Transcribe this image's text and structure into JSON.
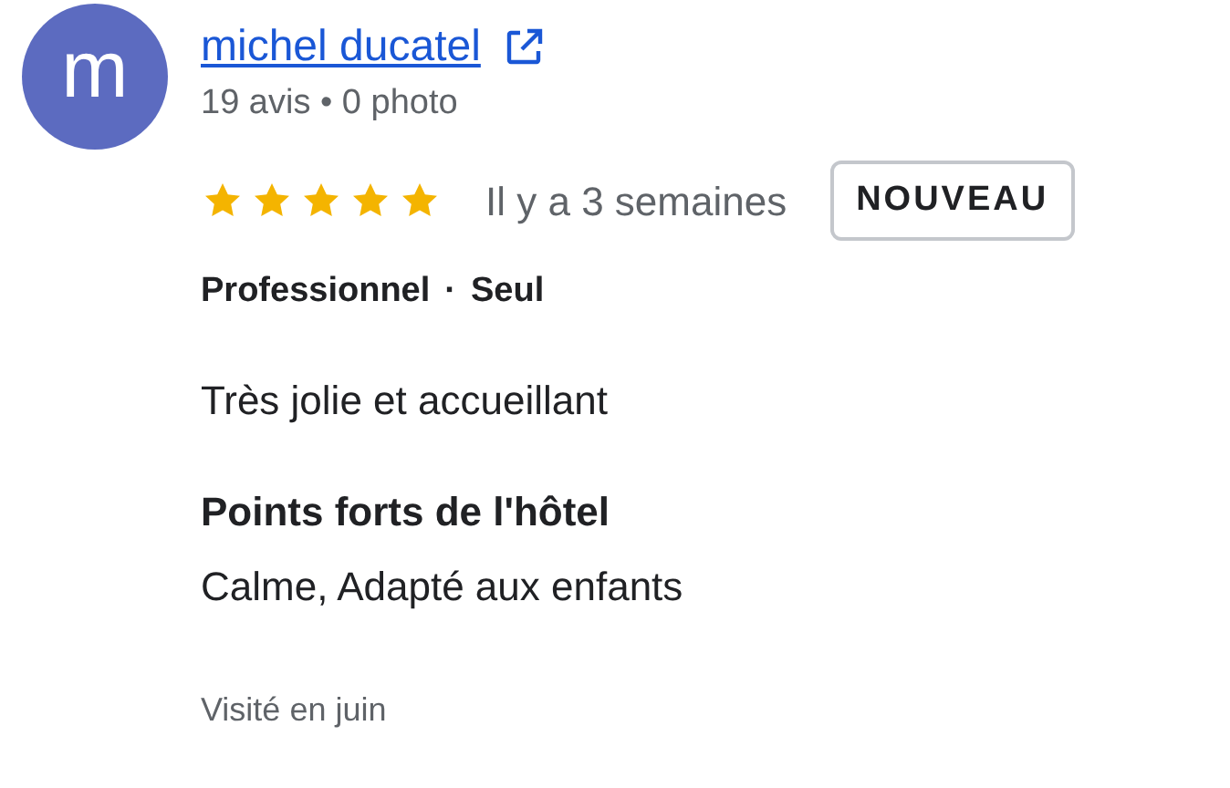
{
  "reviewer": {
    "avatar_letter": "m",
    "name": "michel ducatel",
    "stats": "19 avis • 0 photo"
  },
  "review": {
    "stars": 5,
    "time": "Il y a 3 semaines",
    "badge": "NOUVEAU",
    "trip_type": "Professionnel",
    "separator": "·",
    "company": "Seul",
    "text": "Très jolie et accueillant",
    "highlights_title": "Points forts de l'hôtel",
    "highlights": "Calme, Adapté aux enfants",
    "visited": "Visité en juin"
  }
}
